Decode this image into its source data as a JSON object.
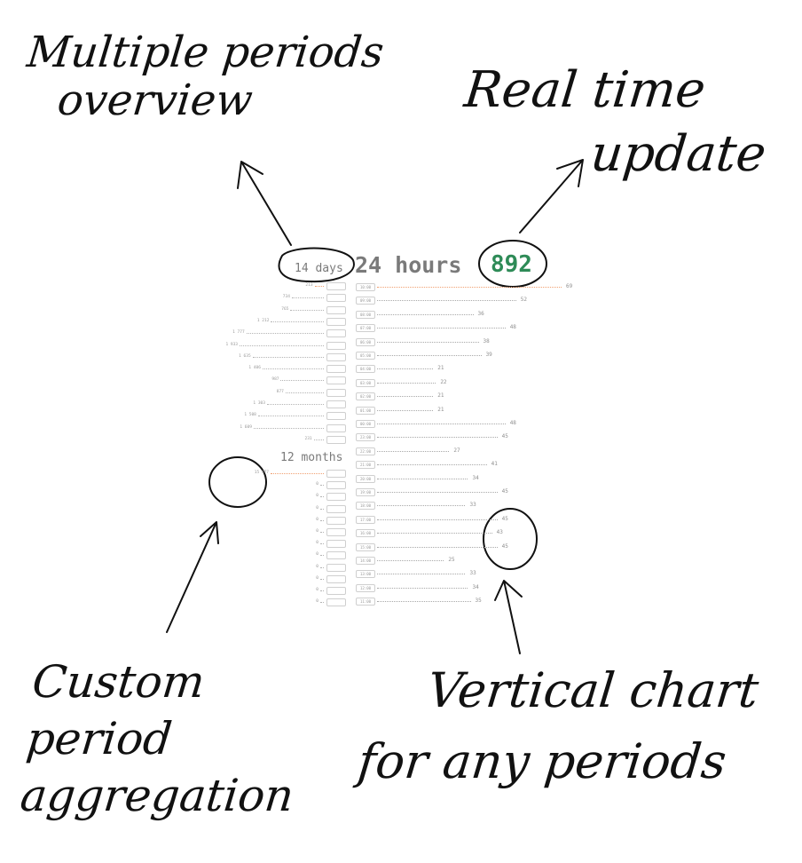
{
  "annotations": {
    "multiple_periods": [
      "Multiple periods",
      "overview"
    ],
    "real_time": [
      "Real time",
      "update"
    ],
    "custom_aggregation": [
      "Custom",
      "period",
      "aggregation"
    ],
    "vertical_chart": [
      "Vertical chart",
      "for any periods"
    ]
  },
  "headers": {
    "days": "14 days",
    "hours": "24 hours",
    "live_counter": "892",
    "months": "12 months"
  },
  "colors": {
    "live_counter": "#2e8b57",
    "highlight_dots": "#f0a070",
    "ink": "#111111"
  },
  "chart_data": [
    {
      "type": "bar",
      "title": "14 days",
      "orientation": "horizontal-right-to-left",
      "categories": [
        "d1",
        "d2",
        "d3",
        "d4",
        "d5",
        "d6",
        "d7",
        "d8",
        "d9",
        "d10",
        "d11",
        "d12",
        "d13",
        "d14"
      ],
      "value_labels": [
        "213",
        "734",
        "765",
        "1 212",
        "1 777",
        "1 933",
        "1 635",
        "1 406",
        "987",
        "877",
        "1 303",
        "1 508",
        "1 609",
        "231"
      ],
      "values": [
        213,
        734,
        765,
        1212,
        1777,
        1933,
        1635,
        1406,
        987,
        877,
        1303,
        1508,
        1609,
        231
      ],
      "highlight_index": 0
    },
    {
      "type": "bar",
      "title": "24 hours",
      "orientation": "horizontal",
      "categories": [
        "10:00",
        "09:00",
        "08:00",
        "07:00",
        "06:00",
        "05:00",
        "04:00",
        "03:00",
        "02:00",
        "01:00",
        "00:00",
        "23:00",
        "22:00",
        "21:00",
        "20:00",
        "19:00",
        "18:00",
        "17:00",
        "16:00",
        "15:00",
        "14:00",
        "13:00",
        "12:00",
        "11:00"
      ],
      "values": [
        69,
        52,
        36,
        48,
        38,
        39,
        21,
        22,
        21,
        21,
        48,
        45,
        27,
        41,
        34,
        45,
        33,
        45,
        43,
        45,
        25,
        33,
        34,
        35
      ],
      "highlight_index": 0
    },
    {
      "type": "bar",
      "title": "12 months",
      "orientation": "horizontal-right-to-left",
      "categories": [
        "m1",
        "m2",
        "m3",
        "m4",
        "m5",
        "m6",
        "m7",
        "m8",
        "m9",
        "m10",
        "m11",
        "m12"
      ],
      "value_labels": [
        "15 477",
        "0",
        "0",
        "0",
        "0",
        "0",
        "0",
        "0",
        "0",
        "0",
        "0",
        "0"
      ],
      "values": [
        15477,
        0,
        0,
        0,
        0,
        0,
        0,
        0,
        0,
        0,
        0,
        0
      ],
      "highlight_index": 0
    }
  ]
}
